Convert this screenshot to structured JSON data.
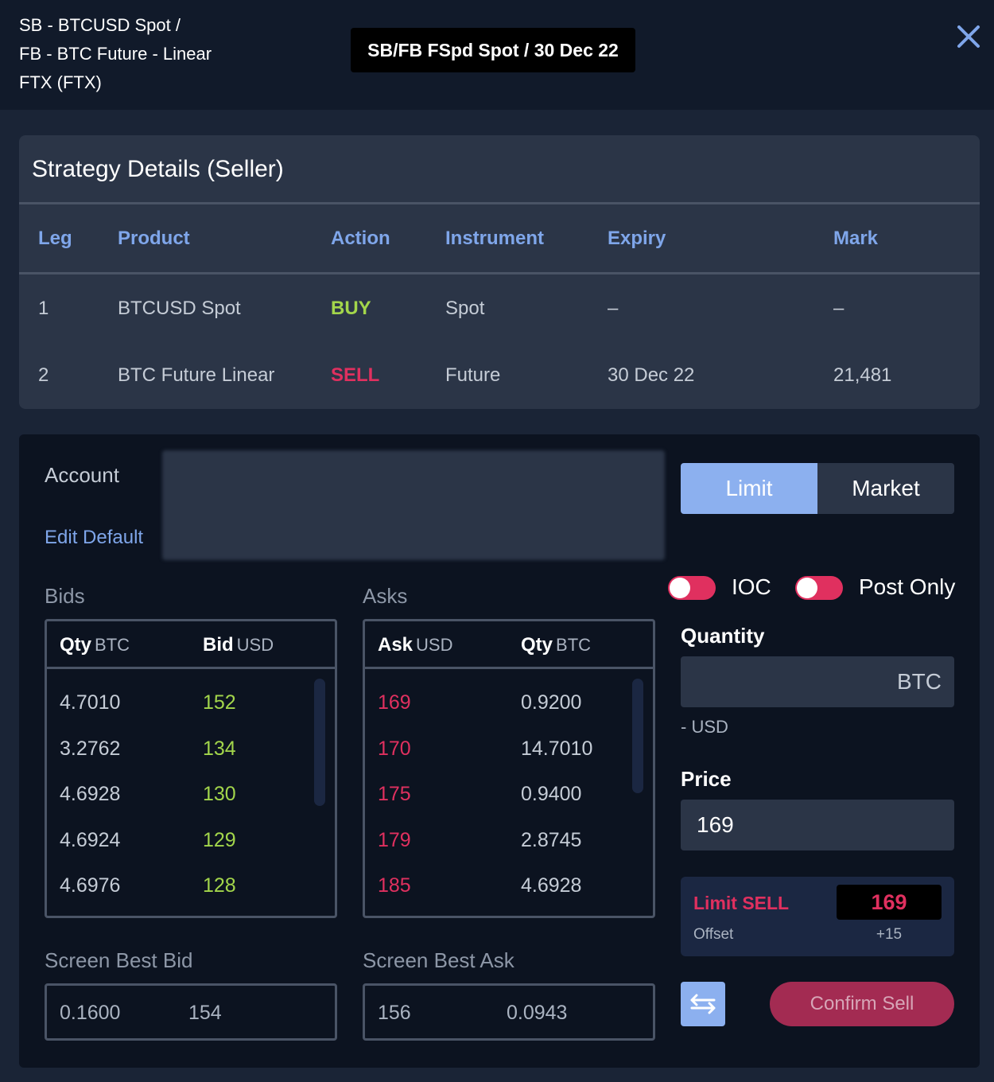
{
  "header": {
    "title_lines": [
      "SB - BTCUSD Spot /",
      "FB - BTC Future - Linear",
      "FTX (FTX)"
    ],
    "badge": "SB/FB FSpd Spot / 30 Dec 22",
    "close_icon": "close-icon"
  },
  "strategy": {
    "title": "Strategy Details (Seller)",
    "columns": [
      "Leg",
      "Product",
      "Action",
      "Instrument",
      "Expiry",
      "Mark"
    ],
    "rows": [
      {
        "leg": "1",
        "product": "BTCUSD Spot",
        "action": "BUY",
        "instrument": "Spot",
        "expiry": "–",
        "mark": "–"
      },
      {
        "leg": "2",
        "product": "BTC Future Linear",
        "action": "SELL",
        "instrument": "Future",
        "expiry": "30 Dec 22",
        "mark": "21,481"
      }
    ]
  },
  "order": {
    "account_label": "Account",
    "edit_default": "Edit Default",
    "order_types": {
      "limit": "Limit",
      "market": "Market",
      "selected": "Limit"
    },
    "toggles": {
      "ioc": "IOC",
      "post_only": "Post Only"
    },
    "bids": {
      "title": "Bids",
      "qty_header": "Qty",
      "qty_unit": "BTC",
      "price_header": "Bid",
      "price_unit": "USD",
      "rows": [
        {
          "qty": "4.7010",
          "price": "152"
        },
        {
          "qty": "3.2762",
          "price": "134"
        },
        {
          "qty": "4.6928",
          "price": "130"
        },
        {
          "qty": "4.6924",
          "price": "129"
        },
        {
          "qty": "4.6976",
          "price": "128"
        }
      ]
    },
    "asks": {
      "title": "Asks",
      "price_header": "Ask",
      "price_unit": "USD",
      "qty_header": "Qty",
      "qty_unit": "BTC",
      "rows": [
        {
          "price": "169",
          "qty": "0.9200"
        },
        {
          "price": "170",
          "qty": "14.7010"
        },
        {
          "price": "175",
          "qty": "0.9400"
        },
        {
          "price": "179",
          "qty": "2.8745"
        },
        {
          "price": "185",
          "qty": "4.6928"
        }
      ]
    },
    "screen_best_bid": {
      "label": "Screen Best Bid",
      "qty": "0.1600",
      "price": "154"
    },
    "screen_best_ask": {
      "label": "Screen Best Ask",
      "price": "156",
      "qty": "0.0943"
    },
    "quantity": {
      "label": "Quantity",
      "unit": "BTC",
      "value": "",
      "notional": "- USD"
    },
    "price": {
      "label": "Price",
      "value": "169"
    },
    "summary": {
      "label": "Limit SELL",
      "price": "169",
      "offset_label": "Offset",
      "offset_value": "+15"
    },
    "confirm_label": "Confirm Sell",
    "swap_icon": "swap-arrows-icon"
  },
  "colors": {
    "buy": "#a3d64b",
    "sell": "#e0305f",
    "accent": "#7fa6ea",
    "limit_active": "#8cb0ef",
    "confirm": "#a32b52"
  }
}
